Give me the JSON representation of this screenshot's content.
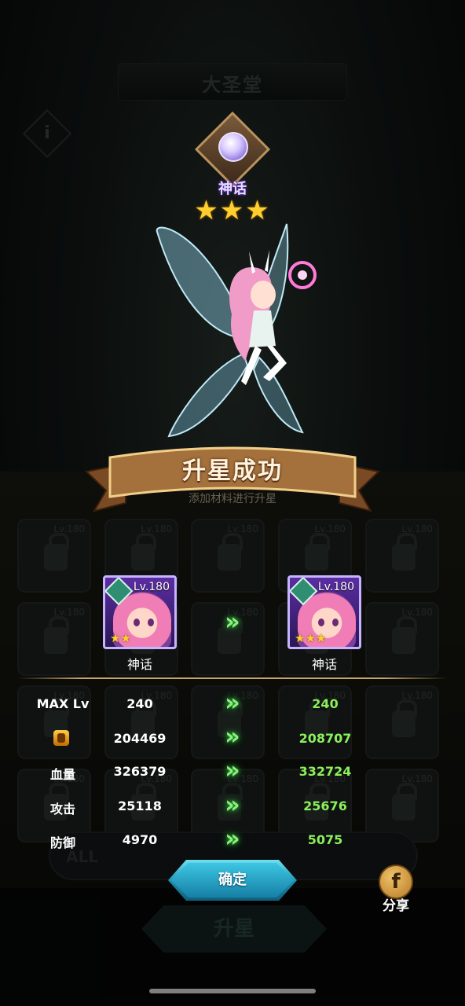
{
  "hall": {
    "title": "大圣堂",
    "info_icon": "i"
  },
  "rank": {
    "label": "神话",
    "stars": "★★★"
  },
  "banner": {
    "title": "升星成功",
    "hint": "添加材料进行升星"
  },
  "background_slots": {
    "level_text": "Lv.180"
  },
  "before_card": {
    "level": "Lv.180",
    "stars": "★★",
    "rank": "神话"
  },
  "after_card": {
    "level": "Lv.180",
    "stars": "★★★",
    "rank": "神话"
  },
  "arrow_glyph": "»",
  "stats": [
    {
      "label": "MAX Lv",
      "old": "240",
      "new": "240"
    },
    {
      "label": "",
      "icon": "power-icon",
      "old": "204469",
      "new": "208707"
    },
    {
      "label": "血量",
      "old": "326379",
      "new": "332724"
    },
    {
      "label": "攻击",
      "old": "25118",
      "new": "25676"
    },
    {
      "label": "防御",
      "old": "4970",
      "new": "5075"
    }
  ],
  "buttons": {
    "confirm": "确定",
    "share": "分享",
    "share_icon": "f",
    "upgrade": "升星",
    "filter_all": "ALL"
  },
  "colors": {
    "stat_increase": "#8bf05a",
    "confirm_button": "#1b8fb2",
    "mythic_frame": "#c7b4ff",
    "star": "#ffcf2e"
  }
}
